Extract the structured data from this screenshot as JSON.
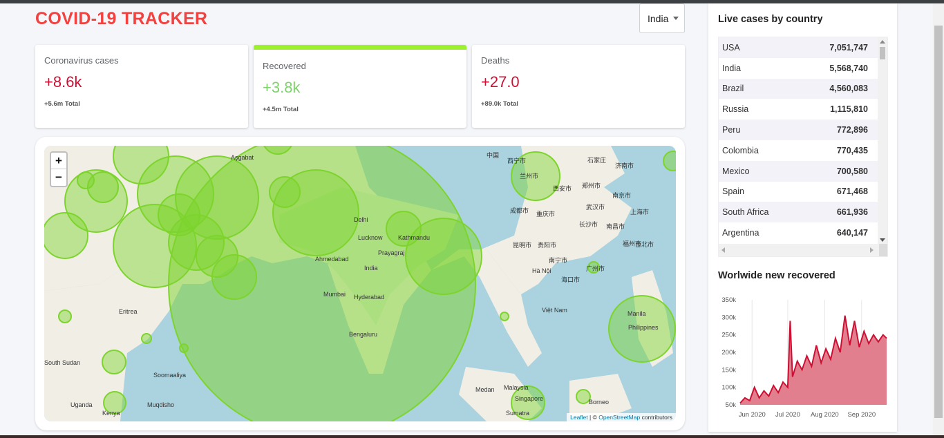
{
  "app": {
    "title": "COVID-19 TRACKER"
  },
  "country_select": {
    "value": "India"
  },
  "cards": {
    "cases": {
      "label": "Coronavirus cases",
      "value": "+8.6k",
      "total": "+5.6m Total"
    },
    "recovered": {
      "label": "Recovered",
      "value": "+3.8k",
      "total": "+4.5m Total"
    },
    "deaths": {
      "label": "Deaths",
      "value": "+27.0",
      "total": "+89.0k Total"
    }
  },
  "map": {
    "zoom_in": "+",
    "zoom_out": "−",
    "attribution": {
      "leaflet": "Leaflet",
      "sep": " | © ",
      "osm": "OpenStreetMap",
      "rest": " contributors"
    },
    "labels": [
      "Aşgabat",
      "Delhi",
      "Lucknow",
      "Kathmandu",
      "Prayagraj",
      "India",
      "Ahmedabad",
      "Mumbai",
      "Hyderabad",
      "Bengaluru",
      "Eritrea",
      "South Sudan",
      "Soomaaliya",
      "Muqdisho",
      "Uganda",
      "Kenya",
      "Medan",
      "Malaysia",
      "Singapore",
      "Sumatra",
      "Borneo",
      "Manila",
      "Philippines",
      "Việt Nam",
      "Hà Nội",
      "中国",
      "西宁市",
      "兰州市",
      "成都市",
      "重庆市",
      "武汉市",
      "上海市",
      "南京市",
      "济南市",
      "石家庄",
      "郑州市",
      "西安市",
      "长沙市",
      "南昌市",
      "福州市",
      "广州市",
      "南宁市",
      "昆明市",
      "贵阳市",
      "海口市",
      "台北市"
    ],
    "marker_color": "#7dd42c"
  },
  "live_cases": {
    "title": "Live cases by country",
    "rows": [
      {
        "country": "USA",
        "cases": "7,051,747"
      },
      {
        "country": "India",
        "cases": "5,568,740"
      },
      {
        "country": "Brazil",
        "cases": "4,560,083"
      },
      {
        "country": "Russia",
        "cases": "1,115,810"
      },
      {
        "country": "Peru",
        "cases": "772,896"
      },
      {
        "country": "Colombia",
        "cases": "770,435"
      },
      {
        "country": "Mexico",
        "cases": "700,580"
      },
      {
        "country": "Spain",
        "cases": "671,468"
      },
      {
        "country": "South Africa",
        "cases": "661,936"
      },
      {
        "country": "Argentina",
        "cases": "640,147"
      }
    ]
  },
  "recovered_chart": {
    "title": "Worlwide new recovered"
  },
  "chart_data": {
    "type": "area",
    "title": "Worlwide new recovered",
    "xlabel": "",
    "ylabel": "",
    "ylim": [
      50000,
      350000
    ],
    "yticks": [
      "350k",
      "300k",
      "250k",
      "200k",
      "150k",
      "100k",
      "50k"
    ],
    "xticks": [
      "Jun 2020",
      "Jul 2020",
      "Aug 2020",
      "Sep 2020"
    ],
    "x": [
      "2020-05-22",
      "2020-05-26",
      "2020-05-30",
      "2020-06-03",
      "2020-06-07",
      "2020-06-11",
      "2020-06-15",
      "2020-06-19",
      "2020-06-23",
      "2020-06-27",
      "2020-07-01",
      "2020-07-03",
      "2020-07-05",
      "2020-07-09",
      "2020-07-13",
      "2020-07-17",
      "2020-07-21",
      "2020-07-25",
      "2020-07-29",
      "2020-08-02",
      "2020-08-06",
      "2020-08-10",
      "2020-08-14",
      "2020-08-18",
      "2020-08-22",
      "2020-08-26",
      "2020-08-30",
      "2020-09-03",
      "2020-09-07",
      "2020-09-11",
      "2020-09-15",
      "2020-09-19",
      "2020-09-22"
    ],
    "series": [
      {
        "values": [
          55000,
          70000,
          62000,
          100000,
          70000,
          90000,
          75000,
          105000,
          85000,
          115000,
          100000,
          290000,
          130000,
          175000,
          150000,
          190000,
          160000,
          220000,
          170000,
          210000,
          180000,
          240000,
          200000,
          305000,
          220000,
          290000,
          215000,
          260000,
          225000,
          250000,
          230000,
          250000,
          240000
        ],
        "color": "#cc1034",
        "fill": "#e27f8f"
      }
    ]
  }
}
